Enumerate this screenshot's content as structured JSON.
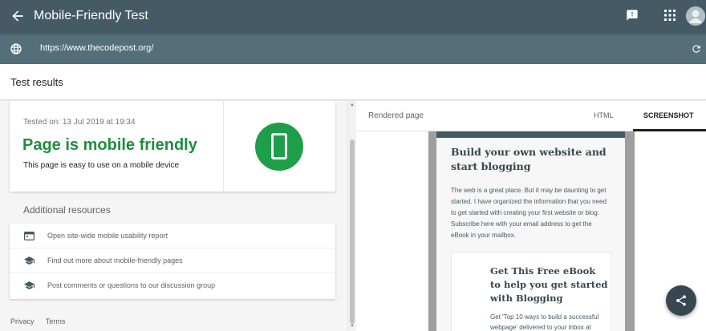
{
  "app": {
    "title": "Mobile-Friendly Test"
  },
  "urlbar": {
    "url": "https://www.thecodepost.org/"
  },
  "results": {
    "title": "Test results"
  },
  "summary": {
    "tested_on": "Tested on: 13 Jul 2019 at 19:34",
    "headline": "Page is mobile friendly",
    "subtitle": "This page is easy to use on a mobile device"
  },
  "resources": {
    "title": "Additional resources",
    "items": [
      {
        "label": "Open site-wide mobile usability report",
        "icon": "report-icon"
      },
      {
        "label": "Find out more about mobile-friendly pages",
        "icon": "school-icon"
      },
      {
        "label": "Post comments or questions to our discussion group",
        "icon": "school-icon"
      }
    ]
  },
  "footer": {
    "privacy": "Privacy",
    "terms": "Terms"
  },
  "rendered": {
    "label": "Rendered page",
    "tabs": {
      "html": "HTML",
      "screenshot": "SCREENSHOT"
    },
    "heading": "Build your own website and start blogging",
    "paragraph": "The web is a great place. But it may be daunting to get started. I have organized the information that you need to get started with creating your first website or blog. Subscribe here with your email address to get the eBook in your mailbox.",
    "promo_heading": "Get This Free eBook to help you get started with Blogging",
    "promo_text": "Get 'Top 10 ways to build a successful webpage' delivered to your inbox at"
  },
  "colors": {
    "appbar": "#455a64",
    "urlbar": "#546e7a",
    "success": "#1e8e3e",
    "badge": "#1e9e48",
    "fab": "#37474f"
  }
}
